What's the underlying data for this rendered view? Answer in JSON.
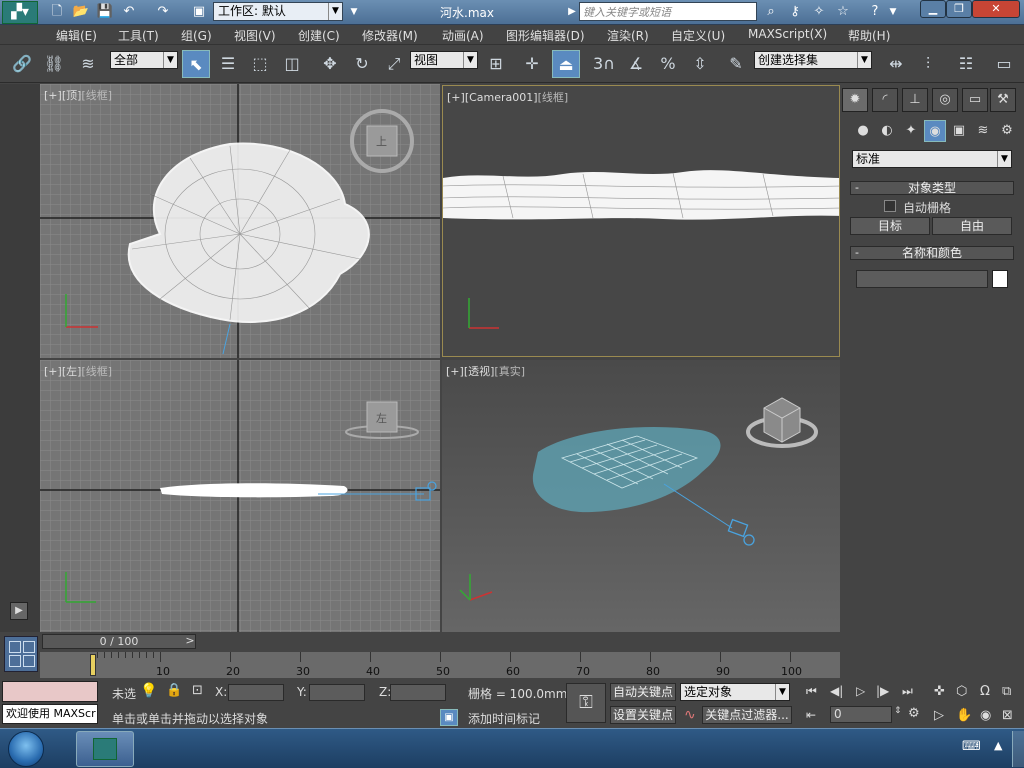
{
  "titlebar": {
    "workspace_label": "工作区: 默认",
    "file_title": "河水.max",
    "search_placeholder": "键入关键字或短语"
  },
  "menu": [
    "编辑(E)",
    "工具(T)",
    "组(G)",
    "视图(V)",
    "创建(C)",
    "修改器(M)",
    "动画(A)",
    "图形编辑器(D)",
    "渲染(R)",
    "自定义(U)",
    "MAXScript(X)",
    "帮助(H)"
  ],
  "toolbar": {
    "selection_filter": "全部",
    "reference_coord": "视图",
    "named_selection": "创建选择集",
    "snap_label": "3"
  },
  "viewports": {
    "top": {
      "bracket": "[+]",
      "name": "[顶]",
      "mode": "[线框]"
    },
    "camera": {
      "bracket": "[+]",
      "name": "[Camera001]",
      "mode": "[线框]"
    },
    "left": {
      "bracket": "[+]",
      "name": "[左]",
      "mode": "[线框]"
    },
    "persp": {
      "bracket": "[+]",
      "name": "[透视]",
      "mode": "[真实]"
    },
    "viewcube_top": "上",
    "viewcube_left": "左"
  },
  "command_panel": {
    "category": "标准",
    "object_type_title": "对象类型",
    "autogrid_label": "自动栅格",
    "target_button": "目标",
    "free_button": "自由",
    "name_color_title": "名称和颜色",
    "name_value": "",
    "swatch_color": "#ffffff"
  },
  "timeline": {
    "frame_display": "0 / 100",
    "ticks": [
      "10",
      "20",
      "30",
      "40",
      "50",
      "60",
      "70",
      "80",
      "90",
      "100"
    ]
  },
  "status": {
    "welcome": "欢迎使用 MAXScr",
    "selection_info": "未选",
    "x_label": "X:",
    "y_label": "Y:",
    "z_label": "Z:",
    "grid_label": "栅格 = 100.0mm",
    "prompt": "单击或单击并拖动以选择对象",
    "add_time_tag": "添加时间标记",
    "auto_key": "自动关键点",
    "set_key": "设置关键点",
    "key_mode": "选定对象",
    "key_filters": "关键点过滤器...",
    "current_frame": "0"
  },
  "colors": {
    "selection_highlight": "#5a8ac0",
    "active_viewport_border": "#9a8a50",
    "water_surface": "#5fa7b8"
  }
}
